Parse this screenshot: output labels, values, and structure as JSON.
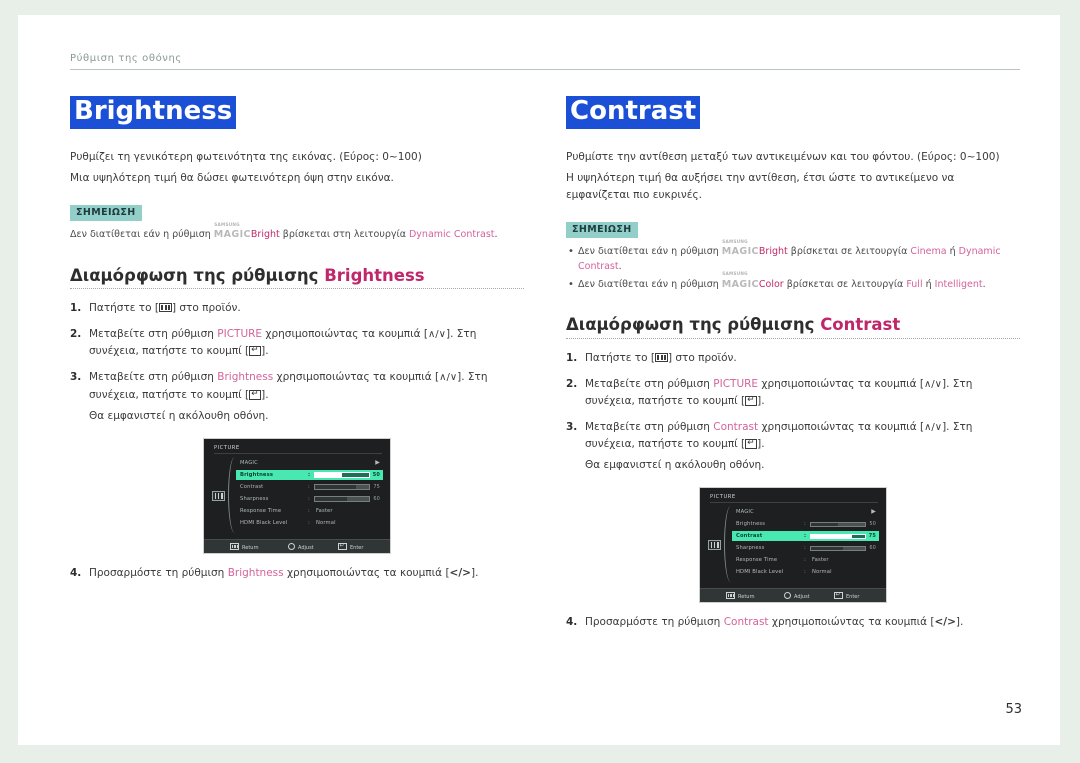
{
  "header": {
    "running_title": "Ρύθμιση της οθόνης"
  },
  "page_number": "53",
  "left_column": {
    "title": "Brightness",
    "desc1": "Ρυθμίζει τη γενικότερη φωτεινότητα της εικόνας. (Εύρος: 0~100)",
    "desc2": "Μια υψηλότερη τιμή θα δώσει φωτεινότερη όψη στην εικόνα.",
    "note_badge": "ΣΗΜΕΙΩΣΗ",
    "note_lines": [
      {
        "pre": "Δεν διατίθεται εάν η ρύθμιση ",
        "logo_samsung": "SAMSUNG",
        "logo_magic": "MAGIC",
        "logo_suffix": "Bright",
        "mid": " βρίσκεται στη λειτουργία ",
        "accent1": "Dynamic Contrast",
        "post": "."
      }
    ],
    "sub_head_plain": "Διαμόρφωση της ρύθμισης ",
    "sub_head_accent": "Brightness",
    "steps": [
      {
        "num": "1.",
        "p1": "Πατήστε το [",
        "glyph": "menu-key",
        "p2": "] στο προϊόν."
      },
      {
        "num": "2.",
        "p1": "Μεταβείτε στη ρύθμιση ",
        "accent": "PICTURE",
        "p2": " χρησιμοποιώντας τα κουμπιά [",
        "arrows": "∧/∨",
        "p3": "]. Στη συνέχεια, πατήστε το κουμπί [",
        "p4": "]."
      },
      {
        "num": "3.",
        "p1": "Μεταβείτε στη ρύθμιση ",
        "accent": "Brightness",
        "p2": " χρησιμοποιώντας τα κουμπιά [",
        "arrows": "∧/∨",
        "p3": "]. Στη συνέχεια, πατήστε το κουμπί [",
        "p4": "].",
        "extra": "Θα εμφανιστεί η ακόλουθη οθόνη."
      },
      {
        "num": "4.",
        "p1": "Προσαρμόστε τη ρύθμιση ",
        "accent": "Brightness",
        "p2": " χρησιμοποιώντας τα κουμπιά [",
        "lr": "</>",
        "p3": "]."
      }
    ],
    "osd": {
      "title": "PICTURE",
      "rows": [
        {
          "label": "MAGIC",
          "kind": "arrow",
          "arrow": "▶"
        },
        {
          "label": "Brightness",
          "kind": "bar",
          "value": "50",
          "percent": 50,
          "selected": true
        },
        {
          "label": "Contrast",
          "kind": "bar",
          "value": "75",
          "percent": 75,
          "selected": false
        },
        {
          "label": "Sharpness",
          "kind": "bar",
          "value": "60",
          "percent": 60,
          "selected": false
        },
        {
          "label": "Response Time",
          "kind": "text",
          "value": "Faster",
          "selected": false
        },
        {
          "label": "HDMI Black Level",
          "kind": "text",
          "value": "Normal",
          "selected": false
        }
      ],
      "footer": [
        {
          "icon": "menu-icon",
          "label": "Return"
        },
        {
          "icon": "adjust-icon",
          "label": "Adjust"
        },
        {
          "icon": "enter-icon",
          "label": "Enter"
        }
      ]
    }
  },
  "right_column": {
    "title": "Contrast",
    "desc1": "Ρυθμίστε την αντίθεση μεταξύ των αντικειμένων και του φόντου. (Εύρος: 0~100)",
    "desc2": "Η υψηλότερη τιμή θα αυξήσει την αντίθεση, έτσι ώστε το αντικείμενο να εμφανίζεται πιο ευκρινές.",
    "note_badge": "ΣΗΜΕΙΩΣΗ",
    "note_lines": [
      {
        "pre": "Δεν διατίθεται εάν η ρύθμιση ",
        "logo_samsung": "SAMSUNG",
        "logo_magic": "MAGIC",
        "logo_suffix": "Bright",
        "mid": " βρίσκεται σε λειτουργία ",
        "accent1": "Cinema",
        "conj": " ή ",
        "accent2": "Dynamic Contrast",
        "post": "."
      },
      {
        "pre": "Δεν διατίθεται εάν η ρύθμιση ",
        "logo_samsung": "SAMSUNG",
        "logo_magic": "MAGIC",
        "logo_suffix": "Color",
        "mid": " βρίσκεται σε λειτουργία ",
        "accent1": "Full",
        "conj": " ή ",
        "accent2": "Intelligent",
        "post": "."
      }
    ],
    "sub_head_plain": "Διαμόρφωση της ρύθμισης ",
    "sub_head_accent": "Contrast",
    "steps": [
      {
        "num": "1.",
        "p1": "Πατήστε το [",
        "glyph": "menu-key",
        "p2": "] στο προϊόν."
      },
      {
        "num": "2.",
        "p1": "Μεταβείτε στη ρύθμιση ",
        "accent": "PICTURE",
        "p2": " χρησιμοποιώντας τα κουμπιά [",
        "arrows": "∧/∨",
        "p3": "]. Στη συνέχεια, πατήστε το κουμπί [",
        "p4": "]."
      },
      {
        "num": "3.",
        "p1": "Μεταβείτε στη ρύθμιση ",
        "accent": "Contrast",
        "p2": " χρησιμοποιώντας τα κουμπιά [",
        "arrows": "∧/∨",
        "p3": "]. Στη συνέχεια, πατήστε το κουμπί [",
        "p4": "].",
        "extra": "Θα εμφανιστεί η ακόλουθη οθόνη."
      },
      {
        "num": "4.",
        "p1": "Προσαρμόστε τη ρύθμιση ",
        "accent": "Contrast",
        "p2": " χρησιμοποιώντας τα κουμπιά [",
        "lr": "</>",
        "p3": "]."
      }
    ],
    "osd": {
      "title": "PICTURE",
      "rows": [
        {
          "label": "MAGIC",
          "kind": "arrow",
          "arrow": "▶"
        },
        {
          "label": "Brightness",
          "kind": "bar",
          "value": "50",
          "percent": 50,
          "selected": false
        },
        {
          "label": "Contrast",
          "kind": "bar",
          "value": "75",
          "percent": 75,
          "selected": true
        },
        {
          "label": "Sharpness",
          "kind": "bar",
          "value": "60",
          "percent": 60,
          "selected": false
        },
        {
          "label": "Response Time",
          "kind": "text",
          "value": "Faster",
          "selected": false
        },
        {
          "label": "HDMI Black Level",
          "kind": "text",
          "value": "Normal",
          "selected": false
        }
      ],
      "footer": [
        {
          "icon": "menu-icon",
          "label": "Return"
        },
        {
          "icon": "adjust-icon",
          "label": "Adjust"
        },
        {
          "icon": "enter-icon",
          "label": "Enter"
        }
      ]
    }
  },
  "colors": {
    "title_bg": "#1a4fd6",
    "note_badge_bg": "#93cfc9",
    "accent_pink": "#c0276b",
    "osd_highlight": "#49e8b0"
  }
}
